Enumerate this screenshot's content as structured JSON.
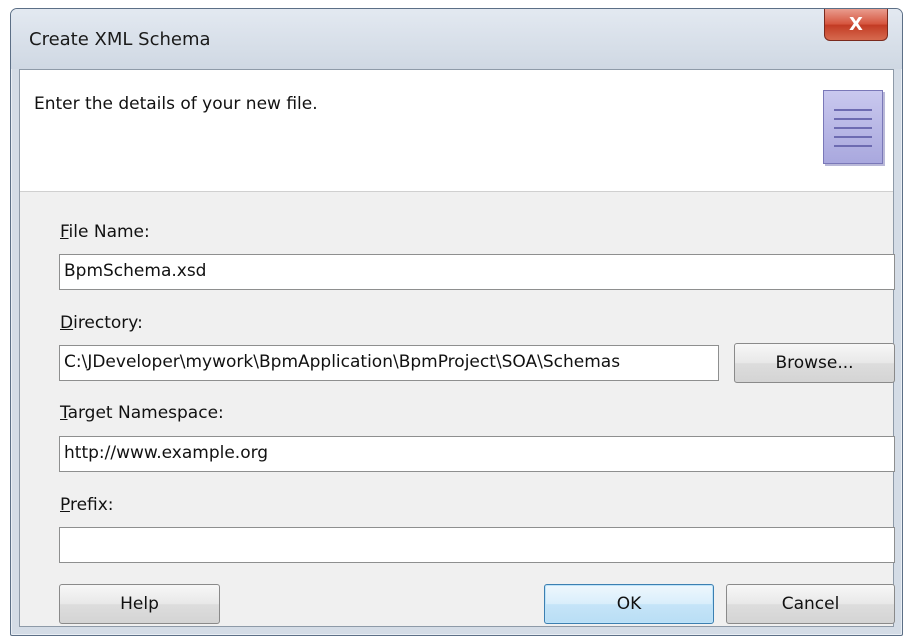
{
  "window": {
    "title": "Create XML Schema",
    "close_glyph": "X"
  },
  "banner": {
    "text": "Enter the details of your new file.",
    "icon": "document-icon"
  },
  "fields": {
    "file_name": {
      "label_mnemonic": "F",
      "label_rest": "ile Name:",
      "value": "BpmSchema.xsd"
    },
    "directory": {
      "label_mnemonic": "D",
      "label_rest": "irectory:",
      "value": "C:\\JDeveloper\\mywork\\BpmApplication\\BpmProject\\SOA\\Schemas"
    },
    "target_namespace": {
      "label_mnemonic": "T",
      "label_rest": "arget Namespace:",
      "value": "http://www.example.org"
    },
    "prefix": {
      "label_mnemonic": "P",
      "label_rest": "refix:",
      "value": ""
    }
  },
  "buttons": {
    "browse": "Browse...",
    "help": "Help",
    "ok": "OK",
    "cancel": "Cancel"
  },
  "colors": {
    "close_button": "#c9432c",
    "default_button_border": "#3c7fb1",
    "icon_fill": "#b8b7e6"
  }
}
